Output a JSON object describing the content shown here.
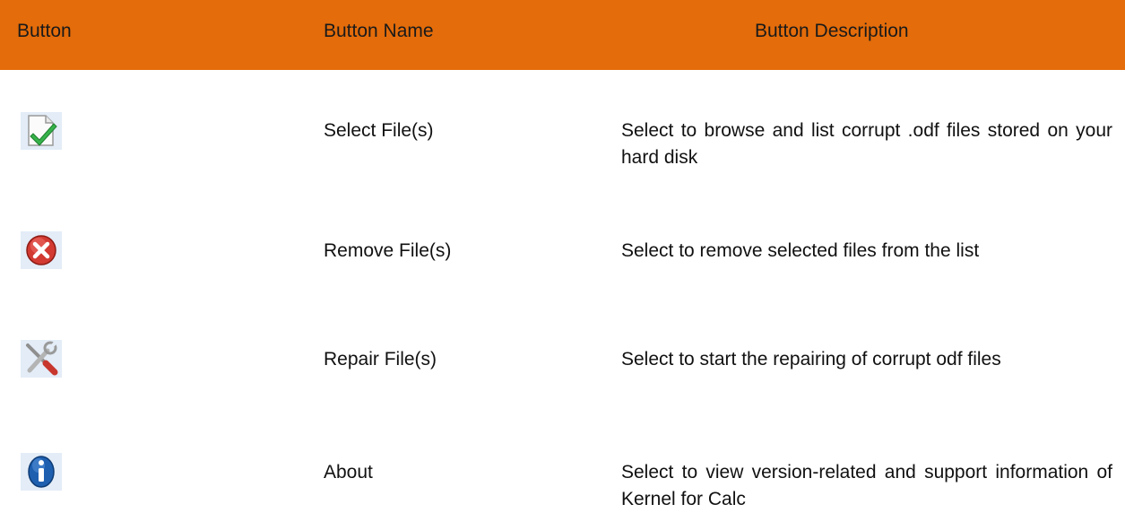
{
  "header": {
    "col_button": "Button",
    "col_name": "Button Name",
    "col_description": "Button Description",
    "background_color": "#e46c0a"
  },
  "rows": [
    {
      "icon": "select-file-icon",
      "name": "Select File(s)",
      "description": "Select to browse and list corrupt .odf files stored on your hard disk"
    },
    {
      "icon": "remove-file-icon",
      "name": "Remove File(s)",
      "description": "Select to remove selected files from the list"
    },
    {
      "icon": "repair-file-icon",
      "name": "Repair File(s)",
      "description": "Select to start the repairing of corrupt odf files"
    },
    {
      "icon": "about-info-icon",
      "name": "About",
      "description": "Select to view version-related and support information of Kernel for Calc"
    }
  ]
}
